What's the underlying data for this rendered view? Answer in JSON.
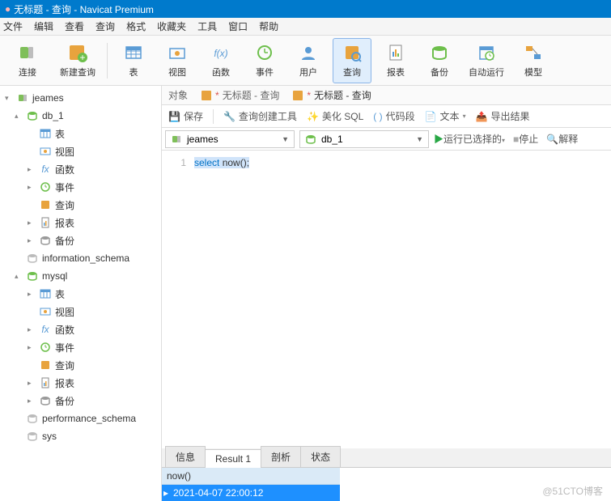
{
  "title": "无标题 - 查询 - Navicat Premium",
  "menu": [
    "文件",
    "编辑",
    "查看",
    "查询",
    "格式",
    "收藏夹",
    "工具",
    "窗口",
    "帮助"
  ],
  "toolbar": [
    {
      "label": "连接",
      "key": "connect"
    },
    {
      "label": "新建查询",
      "key": "newquery",
      "sep": true
    },
    {
      "label": "表",
      "key": "table"
    },
    {
      "label": "视图",
      "key": "view"
    },
    {
      "label": "函数",
      "key": "func"
    },
    {
      "label": "事件",
      "key": "event"
    },
    {
      "label": "用户",
      "key": "user"
    },
    {
      "label": "查询",
      "key": "query",
      "active": true
    },
    {
      "label": "报表",
      "key": "report"
    },
    {
      "label": "备份",
      "key": "backup"
    },
    {
      "label": "自动运行",
      "key": "auto"
    },
    {
      "label": "模型",
      "key": "model"
    }
  ],
  "tree": [
    {
      "label": "jeames",
      "type": "conn",
      "depth": 0,
      "expand": "▾"
    },
    {
      "label": "db_1",
      "type": "db",
      "depth": 1,
      "expand": "▴"
    },
    {
      "label": "表",
      "type": "table",
      "depth": 2,
      "expand": ""
    },
    {
      "label": "视图",
      "type": "view",
      "depth": 2,
      "expand": ""
    },
    {
      "label": "函数",
      "type": "func",
      "depth": 2,
      "expand": "▸"
    },
    {
      "label": "事件",
      "type": "event",
      "depth": 2,
      "expand": "▸"
    },
    {
      "label": "查询",
      "type": "query",
      "depth": 2,
      "expand": ""
    },
    {
      "label": "报表",
      "type": "report",
      "depth": 2,
      "expand": "▸"
    },
    {
      "label": "备份",
      "type": "backup",
      "depth": 2,
      "expand": "▸"
    },
    {
      "label": "information_schema",
      "type": "db-off",
      "depth": 1,
      "expand": ""
    },
    {
      "label": "mysql",
      "type": "db",
      "depth": 1,
      "expand": "▴"
    },
    {
      "label": "表",
      "type": "table",
      "depth": 2,
      "expand": "▸"
    },
    {
      "label": "视图",
      "type": "view",
      "depth": 2,
      "expand": ""
    },
    {
      "label": "函数",
      "type": "func",
      "depth": 2,
      "expand": "▸"
    },
    {
      "label": "事件",
      "type": "event",
      "depth": 2,
      "expand": "▸"
    },
    {
      "label": "查询",
      "type": "query",
      "depth": 2,
      "expand": ""
    },
    {
      "label": "报表",
      "type": "report",
      "depth": 2,
      "expand": "▸"
    },
    {
      "label": "备份",
      "type": "backup",
      "depth": 2,
      "expand": "▸"
    },
    {
      "label": "performance_schema",
      "type": "db-off",
      "depth": 1,
      "expand": ""
    },
    {
      "label": "sys",
      "type": "db-off",
      "depth": 1,
      "expand": ""
    }
  ],
  "tabs": {
    "t0": "对象",
    "t1": "无标题 - 查询",
    "t2": "无标题 - 查询"
  },
  "subtoolbar": {
    "save": "保存",
    "builder": "查询创建工具",
    "beautify": "美化 SQL",
    "snippet": "代码段",
    "text": "文本",
    "export": "导出结果"
  },
  "selects": {
    "conn": "jeames",
    "db": "db_1",
    "run": "运行已选择的",
    "stop": "停止",
    "explain": "解释"
  },
  "editor": {
    "line": "1",
    "kw": "select",
    "rest": " now();"
  },
  "result": {
    "tabs": [
      "信息",
      "Result 1",
      "剖析",
      "状态"
    ],
    "header": "now()",
    "value": "2021-04-07 22:00:12"
  },
  "watermark": "@51CTO博客"
}
